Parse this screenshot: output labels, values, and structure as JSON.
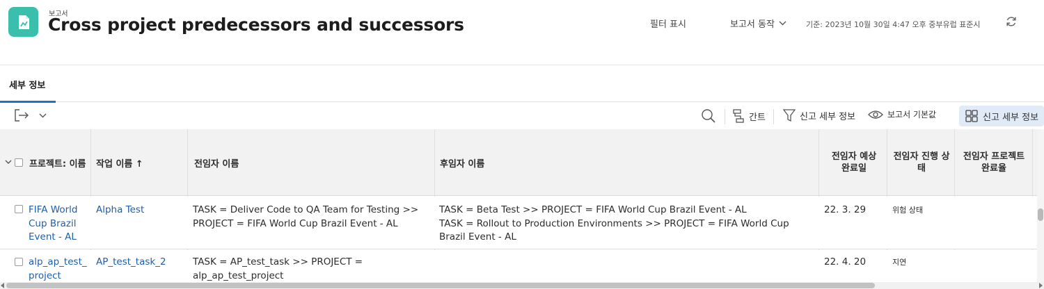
{
  "header": {
    "kicker": "보고서",
    "title": "Cross project predecessors and successors",
    "filter_label": "필터 표시",
    "actions_label": "보고서 동작",
    "as_of": "기준: 2023년 10월 30일 4:47 오후 중부유럽 표준시",
    "icons": {
      "app": "report-chart-icon",
      "actions": "chevron-down-icon",
      "refresh": "refresh-icon"
    },
    "accent_color": "#3bbfad"
  },
  "tabs": [
    {
      "label": "세부 정보",
      "active": true
    }
  ],
  "toolbar": {
    "export_icon": "export-icon",
    "gantt_label": "간트",
    "filter_label": "신고 세부 정보",
    "view_label": "보고서 기본값",
    "group_label": "신고 세부 정보",
    "icons": [
      "search-icon",
      "gantt-icon",
      "filter-icon",
      "eye-icon",
      "grid-icon"
    ]
  },
  "table": {
    "columns": {
      "project": "프로젝트: 이름",
      "task": "작업 이름 ↑",
      "predecessor": "전임자 이름",
      "successor": "후임자 이름",
      "pred_planned_completion": "전임자 예상완료일",
      "pred_status": "전임자 진행 상태",
      "pred_project_percent": "전임자 프로젝트 완료율"
    },
    "rows": [
      {
        "project": "FIFA World Cup Brazil Event - AL",
        "task": "Alpha Test",
        "predecessor": "TASK = Deliver Code to QA Team for Testing >> PROJECT = FIFA World Cup Brazil Event - AL",
        "successor_1": "TASK = Beta Test >> PROJECT = FIFA World Cup Brazil Event - AL",
        "successor_2": "TASK = Rollout to Production Environments >> PROJECT = FIFA World Cup Brazil Event - AL",
        "pred_planned_completion": "22. 3. 29",
        "pred_status": "위험 상태",
        "pred_project_percent": ""
      },
      {
        "project": "alp_ap_test_project",
        "task": "AP_test_task_2",
        "predecessor": "TASK = AP_test_task >> PROJECT = alp_ap_test_project",
        "successor_1": "",
        "successor_2": "",
        "pred_planned_completion": "22. 4. 20",
        "pred_status": "지연",
        "pred_project_percent": ""
      }
    ]
  },
  "colors": {
    "link": "#1f5ea8",
    "tab_active": "#1f6fd1",
    "header_bg": "#f2f2f2",
    "group_active_bg": "#e1ebf7"
  }
}
